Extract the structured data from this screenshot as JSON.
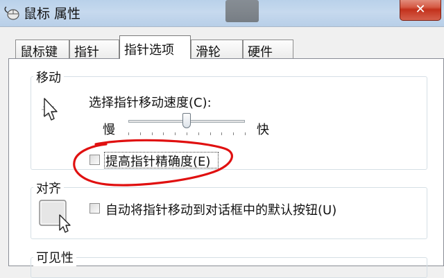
{
  "window": {
    "title": "鼠标 属性",
    "close_label": "✕"
  },
  "tabs": [
    {
      "label": "鼠标键"
    },
    {
      "label": "指针"
    },
    {
      "label": "指针选项",
      "active": true
    },
    {
      "label": "滑轮"
    },
    {
      "label": "硬件"
    }
  ],
  "motion": {
    "group_label": "移动",
    "speed_label": "选择指针移动速度(C):",
    "slow_label": "慢",
    "fast_label": "快",
    "speed_fraction": 0.5,
    "precision_label": "提高指针精确度(E)",
    "precision_checked": false
  },
  "snap": {
    "group_label": "对齐",
    "label": "自动将指针移动到对话框中的默认按钮(U)",
    "checked": false
  },
  "visibility": {
    "group_label": "可见性"
  },
  "annotation": {
    "circle_color": "#e01010"
  },
  "icons": {
    "title": "mouse-icon",
    "motion": "moving-pointer-icon",
    "snap": "snap-to-button-icon"
  }
}
